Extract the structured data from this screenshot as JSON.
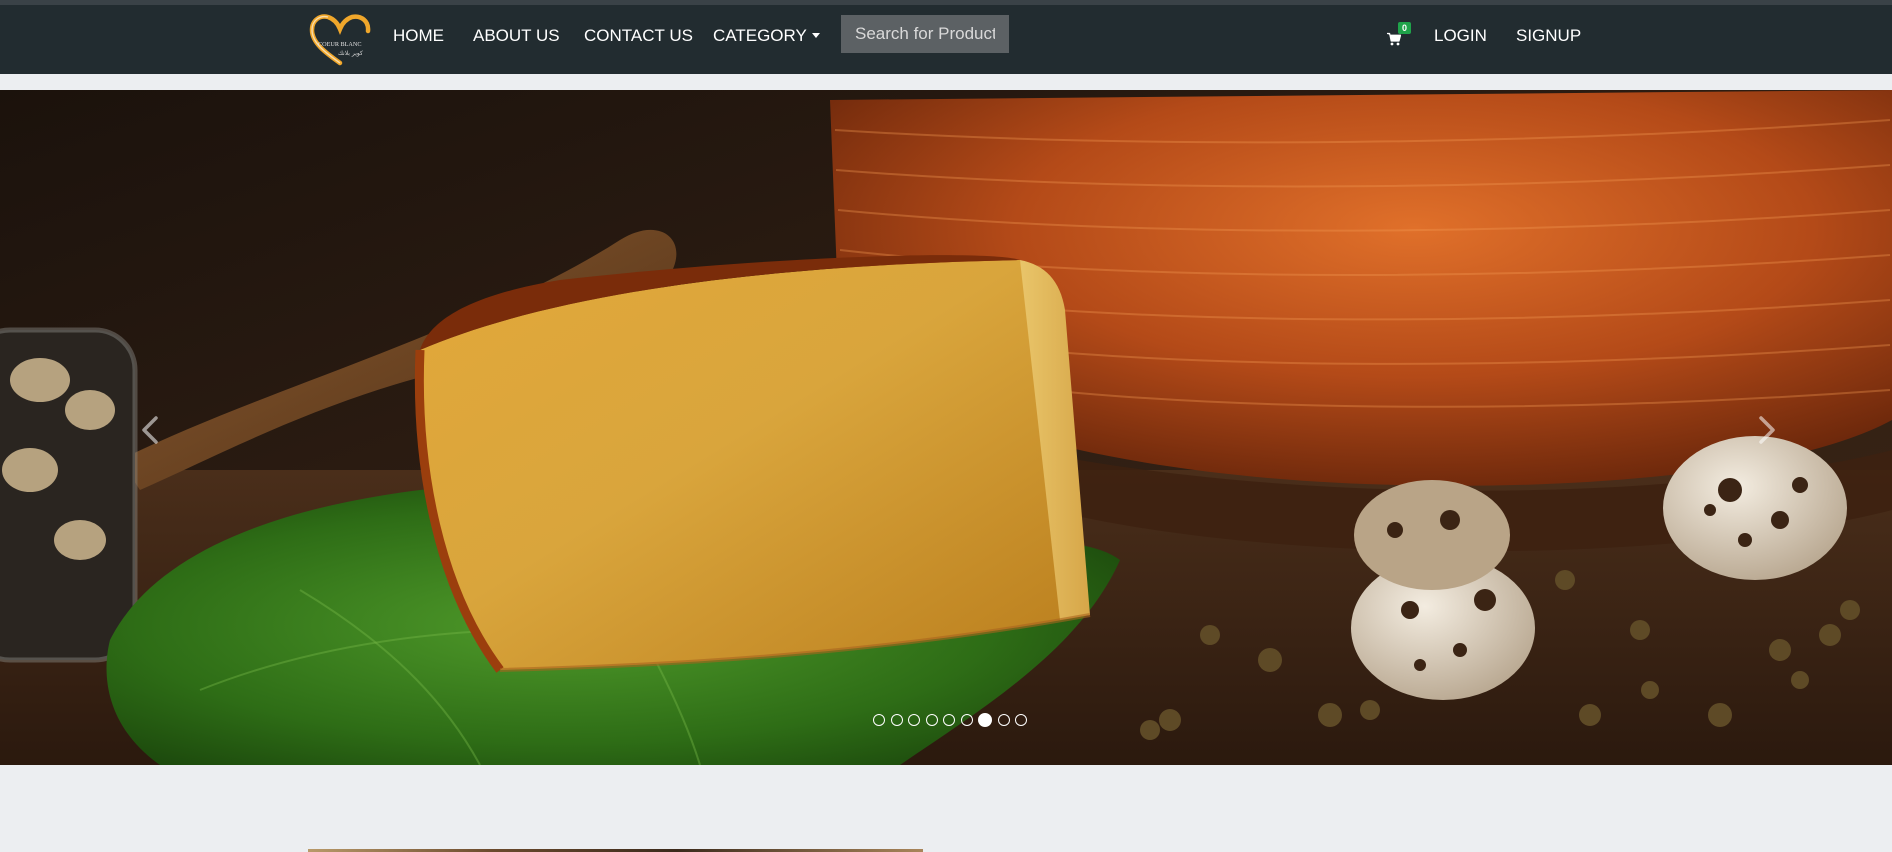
{
  "brand": {
    "name": "COEUR BLANC",
    "tagline": "كوير بلانك",
    "logo_icon": "heart-logo-icon",
    "accent": "#f0a72b"
  },
  "nav": {
    "home": "HOME",
    "about": "ABOUT US",
    "contact": "CONTACT US",
    "category": "CATEGORY"
  },
  "search": {
    "placeholder": "Search for Product",
    "value": ""
  },
  "cart": {
    "icon": "shopping-cart-icon",
    "count": "0",
    "badge_color": "#1fa34a"
  },
  "auth": {
    "login": "LOGIN",
    "signup": "SIGNUP"
  },
  "carousel": {
    "slide_count": 9,
    "active_index": 6,
    "prev_icon": "chevron-left-icon",
    "next_icon": "chevron-right-icon"
  },
  "colors": {
    "navbar": "#222c30",
    "page_background": "#eceef1"
  }
}
